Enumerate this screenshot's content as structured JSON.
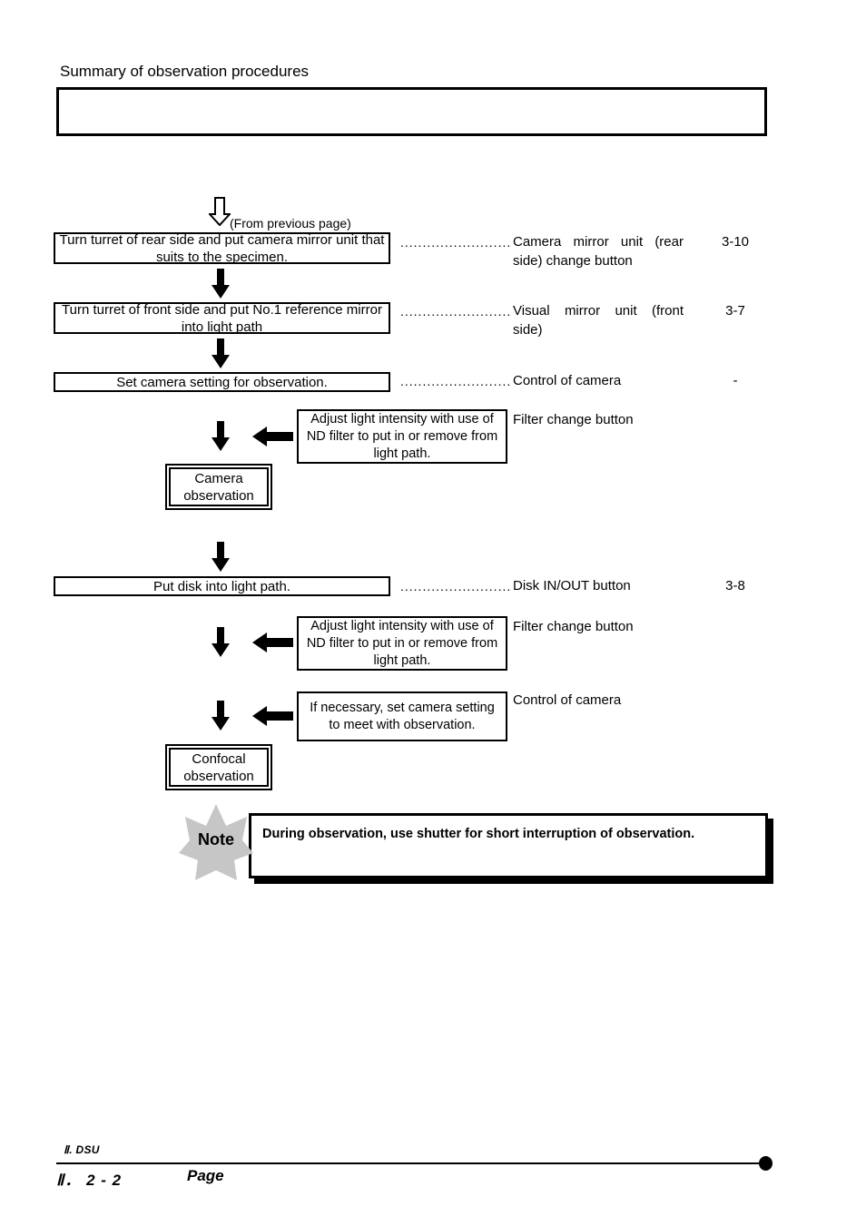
{
  "document": {
    "title": "Summary of observation procedures",
    "header_box_text": ""
  },
  "flow": {
    "entry_note": "(From previous page)",
    "steps": [
      {
        "id": "step-camera-mirror",
        "box_text": "Turn turret of rear side and put camera mirror unit that suits to the specimen.",
        "leader": ".........................",
        "ref_line1": "Camera mirror unit (rear",
        "ref_line2": "side) change button",
        "ref_page": "3-10"
      },
      {
        "id": "step-visual-mirror",
        "box_text": "Turn turret of front side and put No.1 reference mirror into light path",
        "leader": ".........................",
        "ref_line1": "Visual mirror unit (front",
        "ref_line2": "side)",
        "ref_page": "3-7"
      },
      {
        "id": "step-camera-setting",
        "box_text": "Set camera setting for observation.",
        "leader": ".........................",
        "ref_line1": "Control of camera",
        "ref_line2": "",
        "ref_page": "-"
      },
      {
        "id": "step-put-disk",
        "box_text": "Put disk into light path.",
        "leader": ".........................",
        "ref_line1": "Disk IN/OUT button",
        "ref_line2": "",
        "ref_page": "3-8"
      }
    ],
    "side_steps": [
      {
        "id": "side-nd-filter-camera",
        "box_text": "Adjust light intensity with use of ND filter to put in or remove from light path.",
        "ref_label": "Filter change button"
      },
      {
        "id": "side-nd-filter-confocal",
        "box_text": "Adjust light intensity with use of ND filter to put in or remove from light path.",
        "ref_label": "Filter change button"
      },
      {
        "id": "side-camera-setting-confocal",
        "box_text": "If necessary, set camera setting to meet with observation.",
        "ref_label": "Control of camera"
      }
    ],
    "terminals": [
      {
        "id": "terminal-camera",
        "line1": "Camera",
        "line2": "observation"
      },
      {
        "id": "terminal-confocal",
        "line1": "Confocal",
        "line2": "observation"
      }
    ]
  },
  "note": {
    "badge_label": "Note",
    "text": "During observation, use shutter for short interruption of observation.",
    "badge_color": "#c6c6c6"
  },
  "footer": {
    "chapter": "Ⅱ. DSU",
    "page_number": "Ⅱ． 2 - 2",
    "page_word": "Page"
  }
}
